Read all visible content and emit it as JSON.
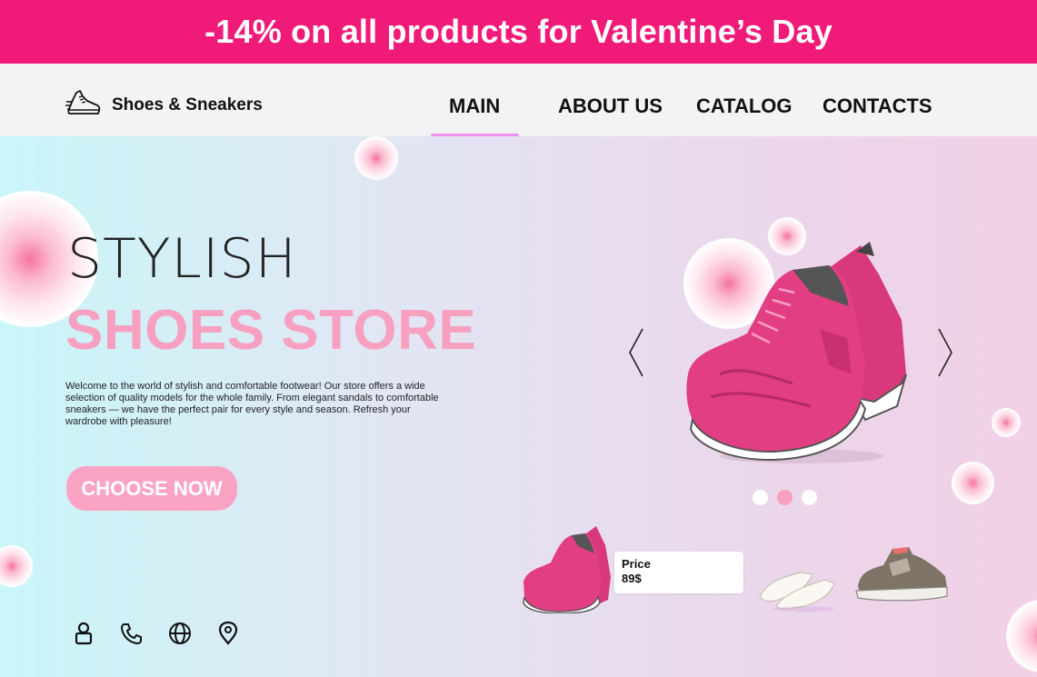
{
  "promo": {
    "text": "-14% on all products for Valentine’s Day"
  },
  "header": {
    "brand": "Shoes & Sneakers",
    "logo_icon": "running-shoe-icon",
    "nav": [
      "MAIN",
      "ABOUT US",
      "CATALOG",
      "CONTACTS"
    ],
    "active_nav": "MAIN"
  },
  "hero": {
    "line1": "STYLISH",
    "line2": "SHOES STORE",
    "description": "Welcome to the world of stylish and comfortable footwear! Our store offers a wide selection of quality models for the whole family. From elegant sandals to comfortable sneakers — we have the perfect pair for every style and season. Refresh your wardrobe with pleasure!",
    "cta": "CHOOSE NOW"
  },
  "carousel": {
    "prev_icon": "chevron-left-icon",
    "next_icon": "chevron-right-icon",
    "slide_count": 3,
    "active_slide": 2
  },
  "products": {
    "price_label": "Price",
    "price_value": "89$"
  },
  "footer_icons": [
    "user-icon",
    "phone-icon",
    "globe-icon",
    "location-pin-icon"
  ],
  "colors": {
    "promo_bg": "#f01a78",
    "accent_pink": "#f7a0c0",
    "nav_underline": "#ee8ff0",
    "shoe_pink": "#e23e84"
  }
}
